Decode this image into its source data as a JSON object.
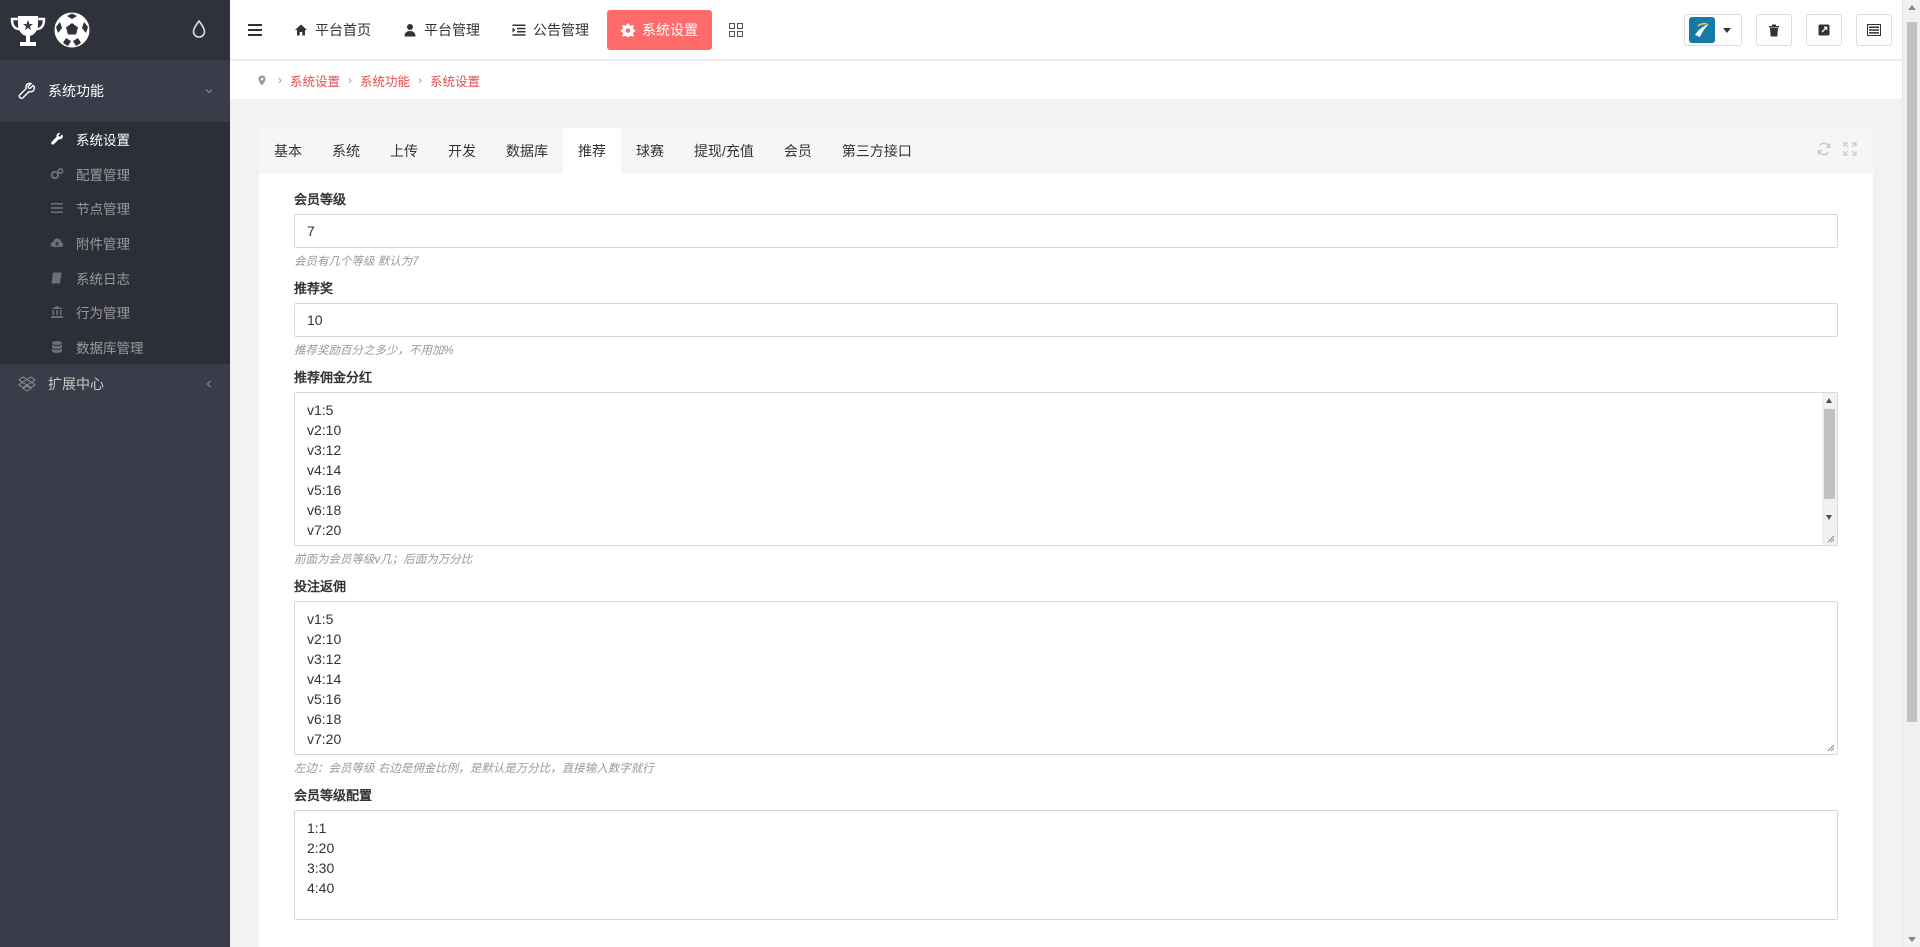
{
  "sidebar": {
    "groups": [
      {
        "label": "系统功能",
        "icon": "wrench-icon",
        "items": [
          {
            "label": "系统设置",
            "icon": "wrench-icon",
            "active": true
          },
          {
            "label": "配置管理",
            "icon": "cogs-icon"
          },
          {
            "label": "节点管理",
            "icon": "list-icon"
          },
          {
            "label": "附件管理",
            "icon": "cloud-upload-icon"
          },
          {
            "label": "系统日志",
            "icon": "book-icon"
          },
          {
            "label": "行为管理",
            "icon": "bank-icon"
          },
          {
            "label": "数据库管理",
            "icon": "database-icon"
          }
        ]
      },
      {
        "label": "扩展中心",
        "icon": "dropbox-icon"
      }
    ]
  },
  "topnav": {
    "items": [
      {
        "label": "平台首页",
        "icon": "home-icon"
      },
      {
        "label": "平台管理",
        "icon": "user-icon"
      },
      {
        "label": "公告管理",
        "icon": "indent-icon"
      },
      {
        "label": "系统设置",
        "icon": "gear-icon",
        "active": true
      }
    ]
  },
  "breadcrumb": [
    "系统设置",
    "系统功能",
    "系统设置"
  ],
  "tabs": [
    "基本",
    "系统",
    "上传",
    "开发",
    "数据库",
    "推荐",
    "球赛",
    "提现/充值",
    "会员",
    "第三方接口"
  ],
  "active_tab": "推荐",
  "fields": {
    "member_level": {
      "label": "会员等级",
      "value": "7",
      "help": "会员有几个等级 默认为7"
    },
    "referral_bonus": {
      "label": "推荐奖",
      "value": "10",
      "help": "推荐奖励百分之多少，不用加%"
    },
    "referral_commission": {
      "label": "推荐佣金分红",
      "lines": [
        "v1:5",
        "v2:10",
        "v3:12",
        "v4:14",
        "v5:16",
        "v6:18",
        "v7:20"
      ],
      "help": "前面为会员等级v几；后面为万分比"
    },
    "bet_rebate": {
      "label": "投注返佣",
      "lines": [
        "v1:5",
        "v2:10",
        "v3:12",
        "v4:14",
        "v5:16",
        "v6:18",
        "v7:20"
      ],
      "help": "左边：会员等级 右边是佣金比例，是默认是万分比，直接输入数字就行"
    },
    "member_level_config": {
      "label": "会员等级配置",
      "lines": [
        "1:1",
        "2:20",
        "3:30",
        "4:40"
      ]
    }
  },
  "colors": {
    "accent": "#ff6b6b",
    "link": "#e84a4a",
    "sidebar_bg": "#393d49",
    "sidebar_sub_bg": "#2c2f37"
  }
}
